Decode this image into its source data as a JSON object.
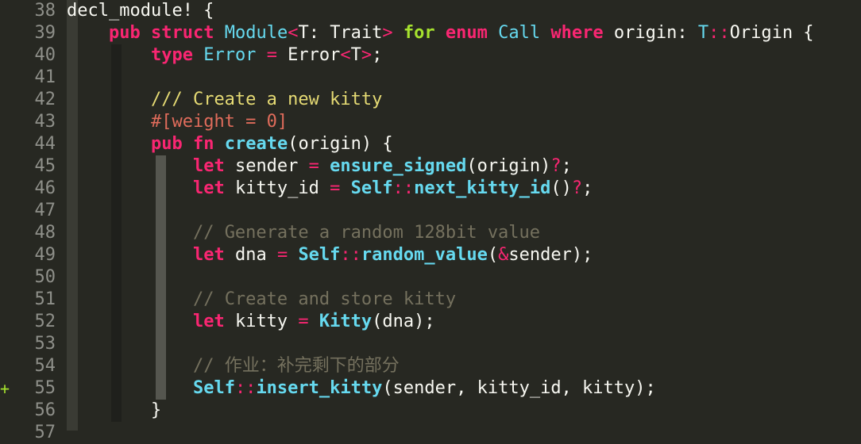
{
  "editor": {
    "colors": {
      "background": "#272822",
      "keyword": "#f92672",
      "type": "#66d9ef",
      "attribute": "#e06c5b",
      "doc_comment": "#e6db74",
      "comment": "#75715e",
      "added_sign": "#a6e22e",
      "line_number": "#8f908a"
    },
    "lines": [
      {
        "num": "38",
        "sign": "",
        "tokens": [
          {
            "t": "decl_module! {",
            "c": "pl"
          }
        ]
      },
      {
        "num": "39",
        "sign": "",
        "tokens": [
          {
            "t": "    ",
            "c": "pl"
          },
          {
            "t": "pub",
            "c": "kw"
          },
          {
            "t": " ",
            "c": "pl"
          },
          {
            "t": "struct",
            "c": "kw"
          },
          {
            "t": " ",
            "c": "pl"
          },
          {
            "t": "Module",
            "c": "ty"
          },
          {
            "t": "<",
            "c": "op"
          },
          {
            "t": "T: Trait",
            "c": "pl"
          },
          {
            "t": ">",
            "c": "op"
          },
          {
            "t": " ",
            "c": "pl"
          },
          {
            "t": "for",
            "c": "ex"
          },
          {
            "t": " ",
            "c": "pl"
          },
          {
            "t": "enum",
            "c": "kw"
          },
          {
            "t": " ",
            "c": "pl"
          },
          {
            "t": "Call",
            "c": "ty"
          },
          {
            "t": " ",
            "c": "pl"
          },
          {
            "t": "where",
            "c": "kw"
          },
          {
            "t": " origin: ",
            "c": "pl"
          },
          {
            "t": "T",
            "c": "ty"
          },
          {
            "t": "::",
            "c": "op"
          },
          {
            "t": "Origin {",
            "c": "pl"
          }
        ]
      },
      {
        "num": "40",
        "sign": "",
        "tokens": [
          {
            "t": "        ",
            "c": "pl"
          },
          {
            "t": "type",
            "c": "kw"
          },
          {
            "t": " ",
            "c": "pl"
          },
          {
            "t": "Error",
            "c": "ty"
          },
          {
            "t": " ",
            "c": "pl"
          },
          {
            "t": "=",
            "c": "op"
          },
          {
            "t": " Error",
            "c": "pl"
          },
          {
            "t": "<",
            "c": "op"
          },
          {
            "t": "T",
            "c": "pl"
          },
          {
            "t": ">",
            "c": "op"
          },
          {
            "t": ";",
            "c": "pl"
          }
        ]
      },
      {
        "num": "41",
        "sign": "",
        "tokens": []
      },
      {
        "num": "42",
        "sign": "",
        "tokens": [
          {
            "t": "        ",
            "c": "pl"
          },
          {
            "t": "/// Create a new kitty",
            "c": "doc"
          }
        ]
      },
      {
        "num": "43",
        "sign": "",
        "tokens": [
          {
            "t": "        ",
            "c": "pl"
          },
          {
            "t": "#[weight = 0]",
            "c": "attr"
          }
        ]
      },
      {
        "num": "44",
        "sign": "",
        "tokens": [
          {
            "t": "        ",
            "c": "pl"
          },
          {
            "t": "pub",
            "c": "kw"
          },
          {
            "t": " ",
            "c": "pl"
          },
          {
            "t": "fn",
            "c": "kw"
          },
          {
            "t": " ",
            "c": "pl"
          },
          {
            "t": "create",
            "c": "fn"
          },
          {
            "t": "(origin) {",
            "c": "pl"
          }
        ]
      },
      {
        "num": "45",
        "sign": "",
        "tokens": [
          {
            "t": "            ",
            "c": "pl"
          },
          {
            "t": "let",
            "c": "kw"
          },
          {
            "t": " sender ",
            "c": "pl"
          },
          {
            "t": "=",
            "c": "op"
          },
          {
            "t": " ",
            "c": "pl"
          },
          {
            "t": "ensure_signed",
            "c": "fn"
          },
          {
            "t": "(origin)",
            "c": "pl"
          },
          {
            "t": "?",
            "c": "op"
          },
          {
            "t": ";",
            "c": "pl"
          }
        ]
      },
      {
        "num": "46",
        "sign": "",
        "tokens": [
          {
            "t": "            ",
            "c": "pl"
          },
          {
            "t": "let",
            "c": "kw"
          },
          {
            "t": " kitty_id ",
            "c": "pl"
          },
          {
            "t": "=",
            "c": "op"
          },
          {
            "t": " ",
            "c": "pl"
          },
          {
            "t": "Self",
            "c": "fn"
          },
          {
            "t": "::",
            "c": "op"
          },
          {
            "t": "next_kitty_id",
            "c": "fn"
          },
          {
            "t": "()",
            "c": "pl"
          },
          {
            "t": "?",
            "c": "op"
          },
          {
            "t": ";",
            "c": "pl"
          }
        ]
      },
      {
        "num": "47",
        "sign": "",
        "tokens": []
      },
      {
        "num": "48",
        "sign": "",
        "tokens": [
          {
            "t": "            ",
            "c": "pl"
          },
          {
            "t": "// Generate a random 128bit value",
            "c": "cm"
          }
        ]
      },
      {
        "num": "49",
        "sign": "",
        "tokens": [
          {
            "t": "            ",
            "c": "pl"
          },
          {
            "t": "let",
            "c": "kw"
          },
          {
            "t": " dna ",
            "c": "pl"
          },
          {
            "t": "=",
            "c": "op"
          },
          {
            "t": " ",
            "c": "pl"
          },
          {
            "t": "Self",
            "c": "fn"
          },
          {
            "t": "::",
            "c": "op"
          },
          {
            "t": "random_value",
            "c": "fn"
          },
          {
            "t": "(",
            "c": "pl"
          },
          {
            "t": "&",
            "c": "op"
          },
          {
            "t": "sender);",
            "c": "pl"
          }
        ]
      },
      {
        "num": "50",
        "sign": "",
        "tokens": []
      },
      {
        "num": "51",
        "sign": "",
        "tokens": [
          {
            "t": "            ",
            "c": "pl"
          },
          {
            "t": "// Create and store kitty",
            "c": "cm"
          }
        ]
      },
      {
        "num": "52",
        "sign": "",
        "tokens": [
          {
            "t": "            ",
            "c": "pl"
          },
          {
            "t": "let",
            "c": "kw"
          },
          {
            "t": " kitty ",
            "c": "pl"
          },
          {
            "t": "=",
            "c": "op"
          },
          {
            "t": " ",
            "c": "pl"
          },
          {
            "t": "Kitty",
            "c": "fn"
          },
          {
            "t": "(dna);",
            "c": "pl"
          }
        ]
      },
      {
        "num": "53",
        "sign": "",
        "tokens": []
      },
      {
        "num": "54",
        "sign": "",
        "tokens": [
          {
            "t": "            ",
            "c": "pl"
          },
          {
            "t": "// 作业：补完剩下的部分",
            "c": "cm"
          }
        ]
      },
      {
        "num": "55",
        "sign": "+",
        "tokens": [
          {
            "t": "            ",
            "c": "pl"
          },
          {
            "t": "Self",
            "c": "fn"
          },
          {
            "t": "::",
            "c": "op"
          },
          {
            "t": "insert_kitty",
            "c": "fn"
          },
          {
            "t": "(sender, kitty_id, kitty);",
            "c": "pl"
          }
        ]
      },
      {
        "num": "56",
        "sign": "",
        "tokens": [
          {
            "t": "        }",
            "c": "pl"
          }
        ]
      },
      {
        "num": "57",
        "sign": "",
        "tokens": []
      }
    ]
  }
}
